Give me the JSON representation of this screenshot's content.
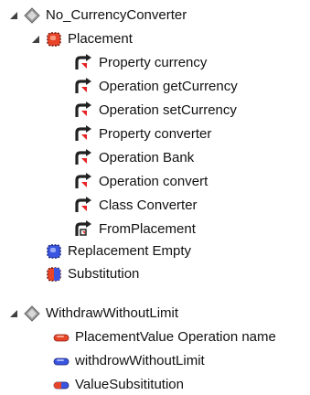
{
  "tree": {
    "root1": {
      "label": "No_CurrencyConverter",
      "icon": "model-diamond-icon",
      "expanded": true,
      "children": {
        "placement": {
          "label": "Placement",
          "icon": "red-package-icon",
          "expanded": true,
          "items": [
            {
              "label": "Property currency",
              "icon": "dependency-arrow-icon"
            },
            {
              "label": "Operation getCurrency",
              "icon": "dependency-arrow-icon"
            },
            {
              "label": "Operation setCurrency",
              "icon": "dependency-arrow-icon"
            },
            {
              "label": "Property converter",
              "icon": "dependency-arrow-icon"
            },
            {
              "label": "Operation Bank",
              "icon": "dependency-arrow-icon"
            },
            {
              "label": "Operation convert",
              "icon": "dependency-arrow-icon"
            },
            {
              "label": "Class Converter",
              "icon": "dependency-arrow-icon"
            },
            {
              "label": "FromPlacement",
              "icon": "dependency-arrow-alt-icon"
            }
          ]
        },
        "replacement": {
          "label": "Replacement Empty",
          "icon": "blue-package-icon"
        },
        "substitution": {
          "label": "Substitution",
          "icon": "red-blue-package-icon"
        }
      }
    },
    "root2": {
      "label": "WithdrawWithoutLimit",
      "icon": "model-diamond-icon",
      "expanded": true,
      "items": [
        {
          "label": "PlacementValue Operation name",
          "icon": "red-pill-icon"
        },
        {
          "label": "withdrowWithoutLimit",
          "icon": "blue-pill-icon"
        },
        {
          "label": "ValueSubsititution",
          "icon": "red-blue-pill-icon"
        }
      ]
    }
  },
  "colors": {
    "red": "#e8442a",
    "blue": "#3a55e0",
    "dark": "#222222"
  }
}
